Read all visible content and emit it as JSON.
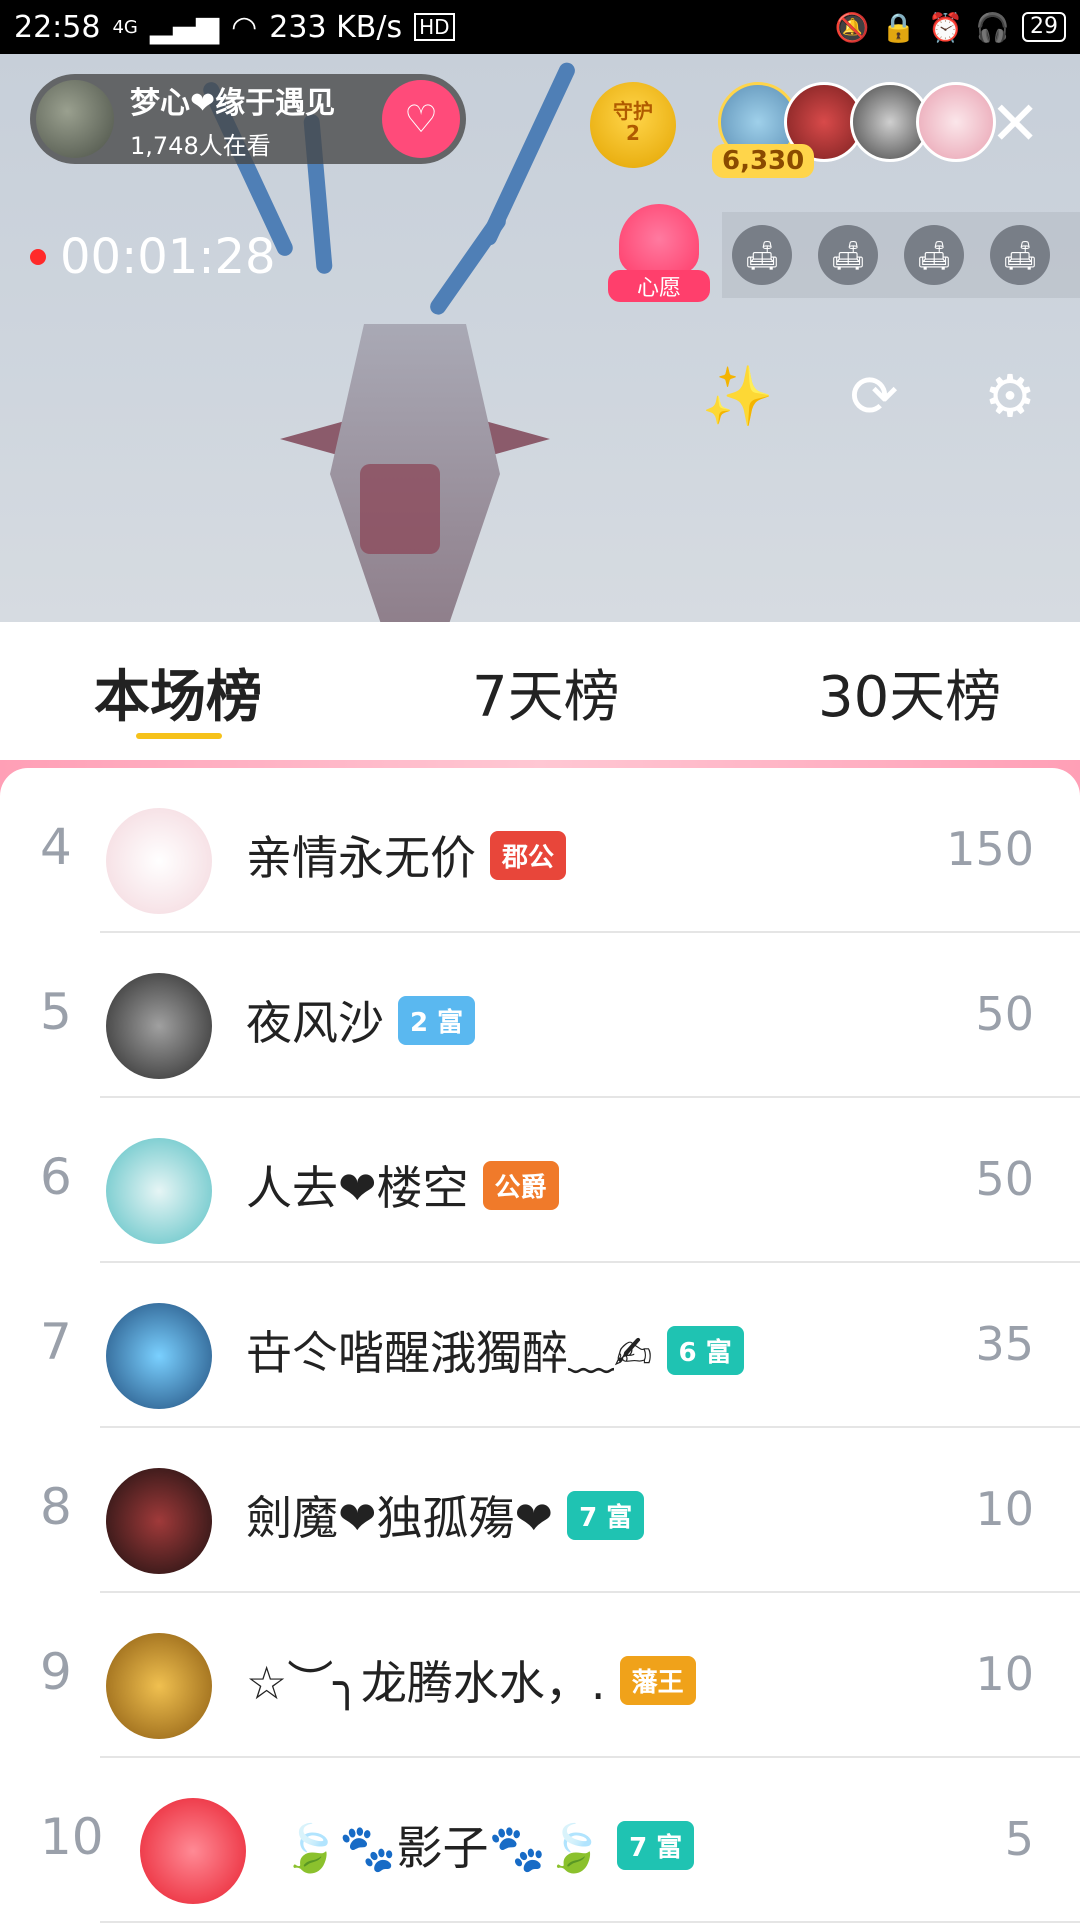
{
  "status_bar": {
    "time": "22:58",
    "network": "4G",
    "speed": "233 KB/s",
    "hd": "HD",
    "battery": "29"
  },
  "live": {
    "anchor_name": "梦心❤缘于遇见",
    "watching": "1,748人在看",
    "follow_icon": "heart-plus-icon",
    "guard_label": "守护",
    "guard_count": "2",
    "coins": "6,330",
    "rec_time": "00:01:28",
    "wish_label": "心愿"
  },
  "tabs": [
    {
      "label": "本场榜"
    },
    {
      "label": "7天榜"
    },
    {
      "label": "30天榜"
    }
  ],
  "rank_list": [
    {
      "rank": "4",
      "name": "亲情永无价",
      "badge": "郡公",
      "badge_color": "#e8463a",
      "score": "150",
      "avatar_color": "#f3d6dc"
    },
    {
      "rank": "5",
      "name": "夜风沙",
      "badge": "2 富",
      "badge_color": "#5ab8f0",
      "score": "50",
      "avatar_color": "#5b5b5b"
    },
    {
      "rank": "6",
      "name": "人去❤楼空",
      "badge": "公爵",
      "badge_color": "#f07a2a",
      "score": "50",
      "avatar_color": "#58c0c4"
    },
    {
      "rank": "7",
      "name": "卋仒喈醒涐獨醉﹏✍",
      "badge": "6 富",
      "badge_color": "#1fc3b2",
      "score": "35",
      "avatar_color": "#1f4b7a"
    },
    {
      "rank": "8",
      "name": "劍魔❤独孤殤❤",
      "badge": "7 富",
      "badge_color": "#1fc3b2",
      "score": "10",
      "avatar_color": "#3a1a1a"
    },
    {
      "rank": "9",
      "name": "☆︶╮龙腾水水，.",
      "badge": "藩王",
      "badge_color": "#f0a21a",
      "score": "10",
      "avatar_color": "#b08a2a"
    },
    {
      "rank": "10",
      "name": "🍃🐾影子🐾🍃",
      "badge": "7 富",
      "badge_color": "#1fc3b2",
      "score": "5",
      "avatar_color": "#ff4a5a"
    }
  ]
}
